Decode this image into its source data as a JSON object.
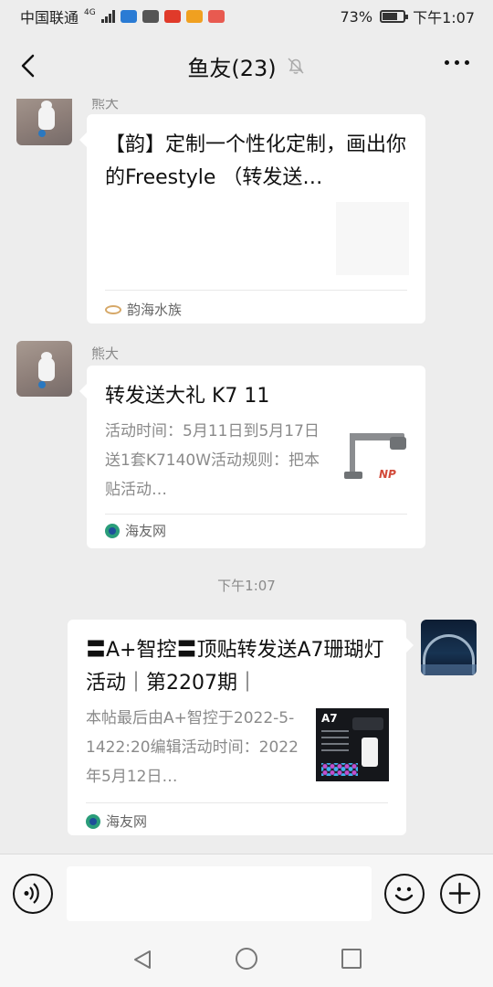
{
  "status_bar": {
    "carrier": "中国联通",
    "network": "4G",
    "battery_percent": "73%",
    "battery_level": 0.73,
    "time": "下午1:07"
  },
  "header": {
    "title": "鱼友(23)",
    "back_icon": "chevron-left-icon",
    "mute_icon": "bell-off-icon",
    "more_icon": "more-horizontal-icon"
  },
  "messages": [
    {
      "sender": "熊大",
      "card_title": "【韵】定制一个性化定制，画出你的Freestyle （转发送…",
      "source": "韵海水族"
    },
    {
      "sender": "熊大",
      "card_title": "转发送大礼 K7 11",
      "card_desc": "活动时间：5月11日到5月17日送1套K7140W活动规则：把本贴活动…",
      "thumb_logo": "NP",
      "source": "海友网"
    },
    {
      "timestamp": "下午1:07"
    },
    {
      "card_title": "〓A+智控〓顶贴转发送A7珊瑚灯活动｜第2207期｜",
      "card_desc": "本帖最后由A+智控于2022-5-1422:20编辑活动时间：2022年5月12日…",
      "thumb_label": "A7",
      "source": "海友网"
    }
  ],
  "input_bar": {
    "voice_icon": "voice-icon",
    "emoji_icon": "emoji-icon",
    "plus_icon": "plus-icon",
    "text_value": ""
  },
  "nav_bar": {
    "back_icon": "nav-back-icon",
    "home_icon": "nav-home-icon",
    "recent_icon": "nav-recent-icon"
  }
}
